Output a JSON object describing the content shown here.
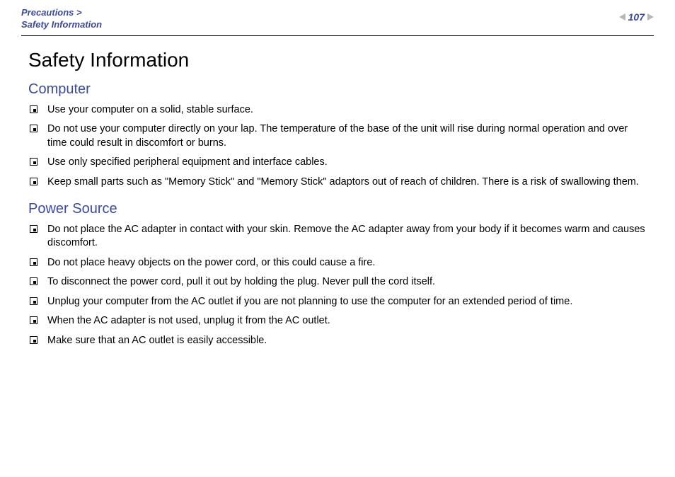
{
  "header": {
    "breadcrumb_line1": "Precautions >",
    "breadcrumb_line2": "Safety Information",
    "page_number": "107"
  },
  "title": "Safety Information",
  "sections": [
    {
      "heading": "Computer",
      "items": [
        "Use your computer on a solid, stable surface.",
        "Do not use your computer directly on your lap. The temperature of the base of the unit will rise during normal operation and over time could result in discomfort or burns.",
        "Use only specified peripheral equipment and interface cables.",
        "Keep small parts such as \"Memory Stick\" and \"Memory Stick\" adaptors out of reach of children. There is a risk of swallowing them."
      ]
    },
    {
      "heading": "Power Source",
      "items": [
        "Do not place the AC adapter in contact with your skin. Remove the AC adapter away from your body if it becomes warm and causes discomfort.",
        "Do not place heavy objects on the power cord, or this could cause a fire.",
        "To disconnect the power cord, pull it out by holding the plug. Never pull the cord itself.",
        "Unplug your computer from the AC outlet if you are not planning to use the computer for an extended period of time.",
        "When the AC adapter is not used, unplug it from the AC outlet.",
        "Make sure that an AC outlet is easily accessible."
      ]
    }
  ]
}
